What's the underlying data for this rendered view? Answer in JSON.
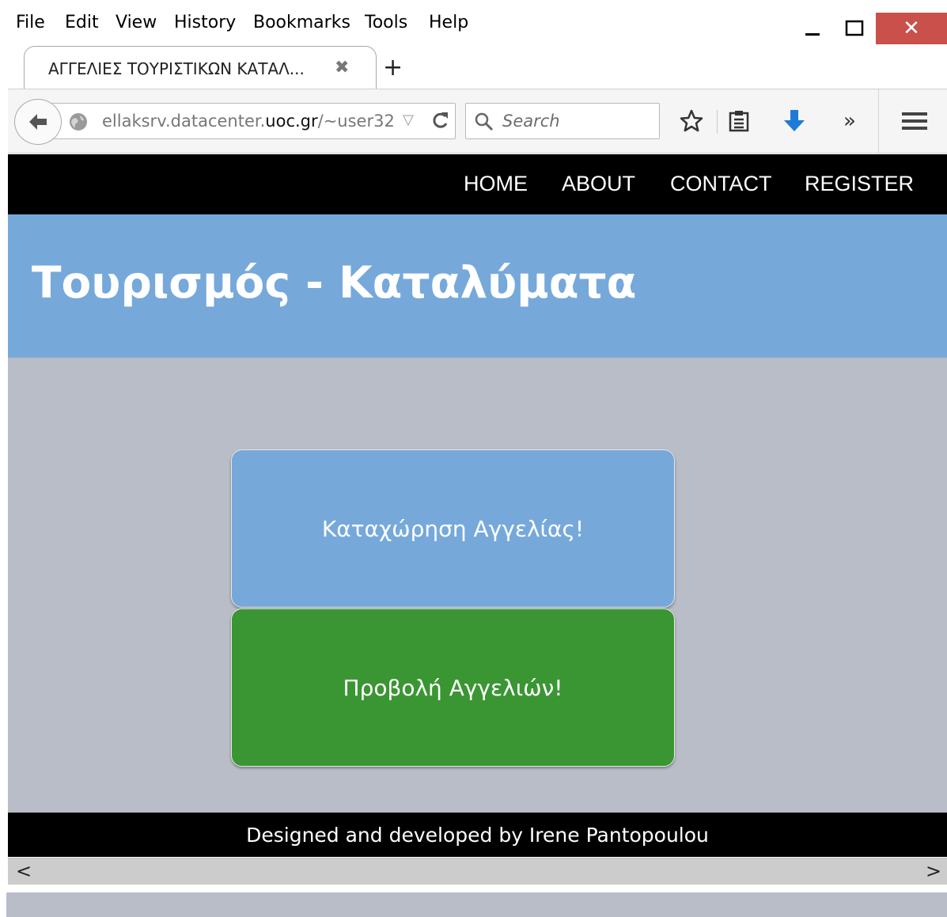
{
  "menubar": {
    "items": [
      "File",
      "Edit",
      "View",
      "History",
      "Bookmarks",
      "Tools",
      "Help"
    ]
  },
  "window_controls": {
    "minimize": "—",
    "maximize": "☐",
    "close": "✕"
  },
  "tab": {
    "title": "ΑΓΓΕΛΙΕΣ ΤΟΥΡΙΣΤΙΚΩΝ ΚΑΤΑΛ...",
    "close": "✖",
    "new_tab": "+"
  },
  "navbar": {
    "url_prefix": "ellaksrv.datacenter.",
    "url_domain": "uoc.gr",
    "url_suffix": "/~user32",
    "search_placeholder": "Search"
  },
  "site": {
    "nav": [
      "HOME",
      "ABOUT",
      "CONTACT",
      "REGISTER"
    ],
    "title": "Τουρισμός - Καταλύματα",
    "button_post": "Καταχώρηση Αγγελίας!",
    "button_view": "Προβολή Αγγελιών!",
    "footer": "Designed and developed by Irene Pantopoulou"
  },
  "scrollbar": {
    "left": "<",
    "right": ">"
  },
  "colors": {
    "hero": "#76a9da",
    "page_bg": "#b8bdc7",
    "green_button": "#3a9632",
    "close_button": "#c9504b",
    "download_icon": "#1f7ad8"
  }
}
